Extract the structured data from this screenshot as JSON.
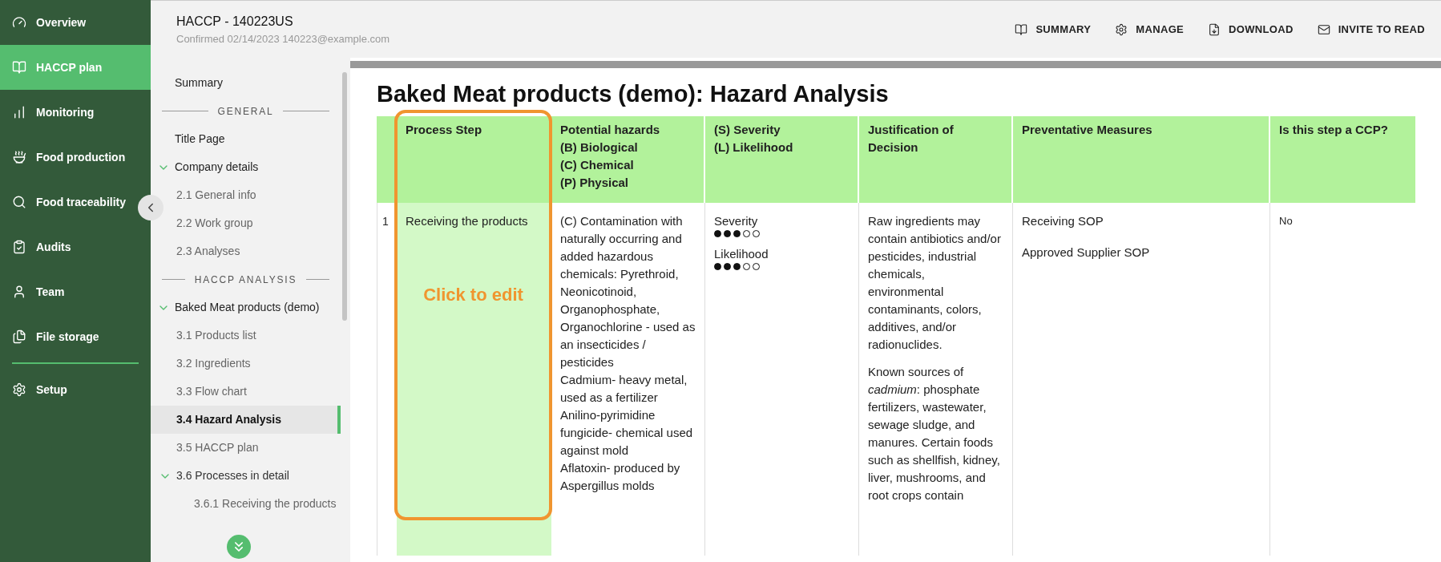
{
  "sidebar": {
    "items": [
      {
        "label": "Overview",
        "selected": false
      },
      {
        "label": "HACCP plan",
        "selected": true
      },
      {
        "label": "Monitoring",
        "selected": false
      },
      {
        "label": "Food production",
        "selected": false
      },
      {
        "label": "Food traceability",
        "selected": false
      },
      {
        "label": "Audits",
        "selected": false
      },
      {
        "label": "Team",
        "selected": false
      },
      {
        "label": "File storage",
        "selected": false
      }
    ],
    "bottom_items": [
      {
        "label": "Setup",
        "selected": false
      }
    ]
  },
  "header": {
    "title": "HACCP - 140223US",
    "subtitle": "Confirmed 02/14/2023 140223@example.com",
    "actions": [
      {
        "label": "SUMMARY"
      },
      {
        "label": "MANAGE"
      },
      {
        "label": "DOWNLOAD"
      },
      {
        "label": "INVITE TO READ"
      }
    ]
  },
  "nav": {
    "items": [
      {
        "kind": "link",
        "label": "Summary",
        "selected": false
      },
      {
        "kind": "section",
        "label": "GENERAL"
      },
      {
        "kind": "link",
        "label": "Title Page",
        "selected": false
      },
      {
        "kind": "group",
        "label": "Company details",
        "expanded": true,
        "children": [
          {
            "kind": "link",
            "label": "2.1 General info",
            "selected": false
          },
          {
            "kind": "link",
            "label": "2.2 Work group",
            "selected": false
          },
          {
            "kind": "link",
            "label": "2.3 Analyses",
            "selected": false
          }
        ]
      },
      {
        "kind": "section",
        "label": "HACCP ANALYSIS"
      },
      {
        "kind": "group",
        "label": "Baked Meat products (demo)",
        "expanded": true,
        "children": [
          {
            "kind": "link",
            "label": "3.1 Products list",
            "selected": false
          },
          {
            "kind": "link",
            "label": "3.2 Ingredients",
            "selected": false
          },
          {
            "kind": "link",
            "label": "3.3 Flow chart",
            "selected": false
          },
          {
            "kind": "link",
            "label": "3.4 Hazard Analysis",
            "selected": true
          },
          {
            "kind": "link",
            "label": "3.5 HACCP plan",
            "selected": false
          },
          {
            "kind": "group",
            "label": "3.6 Processes in detail",
            "expanded": true,
            "children": [
              {
                "kind": "link",
                "label": "3.6.1 Receiving the products",
                "selected": false
              }
            ]
          }
        ]
      }
    ]
  },
  "page": {
    "title": "Baked Meat products (demo): Hazard Analysis"
  },
  "table": {
    "columns": [
      {
        "lines": [
          "Process Step"
        ]
      },
      {
        "lines": [
          "Potential hazards",
          "(B) Biological",
          "(C) Chemical",
          "(P) Physical"
        ]
      },
      {
        "lines": [
          "(S) Severity",
          "(L) Likelihood"
        ]
      },
      {
        "lines": [
          "Justification of Decision"
        ]
      },
      {
        "lines": [
          "Preventative Measures"
        ]
      },
      {
        "lines": [
          "Is this step a CCP?"
        ]
      }
    ],
    "rows": [
      {
        "number": "1",
        "process_step": "Receiving the products",
        "hazards": [
          "(C) Contamination with naturally occurring and added hazardous chemicals: Pyrethroid, Neonicotinoid, Organophosphate, Organochlorine - used as an insecticides / pesticides",
          "Cadmium- heavy metal, used as a fertilizer",
          "Anilino-pyrimidine fungicide- chemical used against mold",
          "Aflatoxin- produced by Aspergillus molds"
        ],
        "ratings": [
          {
            "label": "Severity",
            "stars": 3
          },
          {
            "label": "Likelihood",
            "stars": 3
          }
        ],
        "justification": [
          "Raw ingredients may contain antibiotics and/or pesticides, industrial chemicals, environmental contaminants, colors, additives, and/or radionuclides.",
          "Known sources of *cadmium*: phosphate fertilizers, wastewater, sewage sludge, and manures. Certain foods such as shellfish, kidney, liver, mushrooms, and root crops contain"
        ],
        "measures": [
          "Receiving SOP",
          "Approved Supplier SOP"
        ],
        "ccp": "No"
      }
    ]
  },
  "annotation": {
    "text": "Click to edit"
  }
}
